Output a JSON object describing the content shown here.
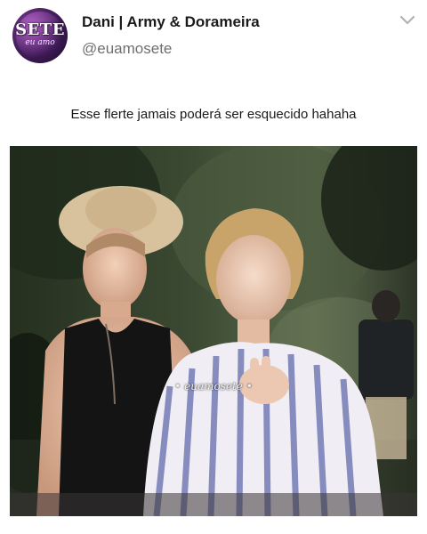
{
  "tweet": {
    "author": {
      "display_name": "Dani | Army & Dorameira",
      "handle": "@euamosete",
      "avatar_title": "SETE",
      "avatar_subtitle": "eu amo"
    },
    "menu_icon": "chevron-down-icon",
    "text": "Esse flerte jamais poderá ser esquecido hahaha",
    "media": {
      "watermark": "• euamosete •"
    }
  },
  "colors": {
    "name": "#1a1a1a",
    "handle": "#6f6f6f",
    "chevron": "#b3b3b3",
    "avatar_bg": "#3f1b57"
  }
}
